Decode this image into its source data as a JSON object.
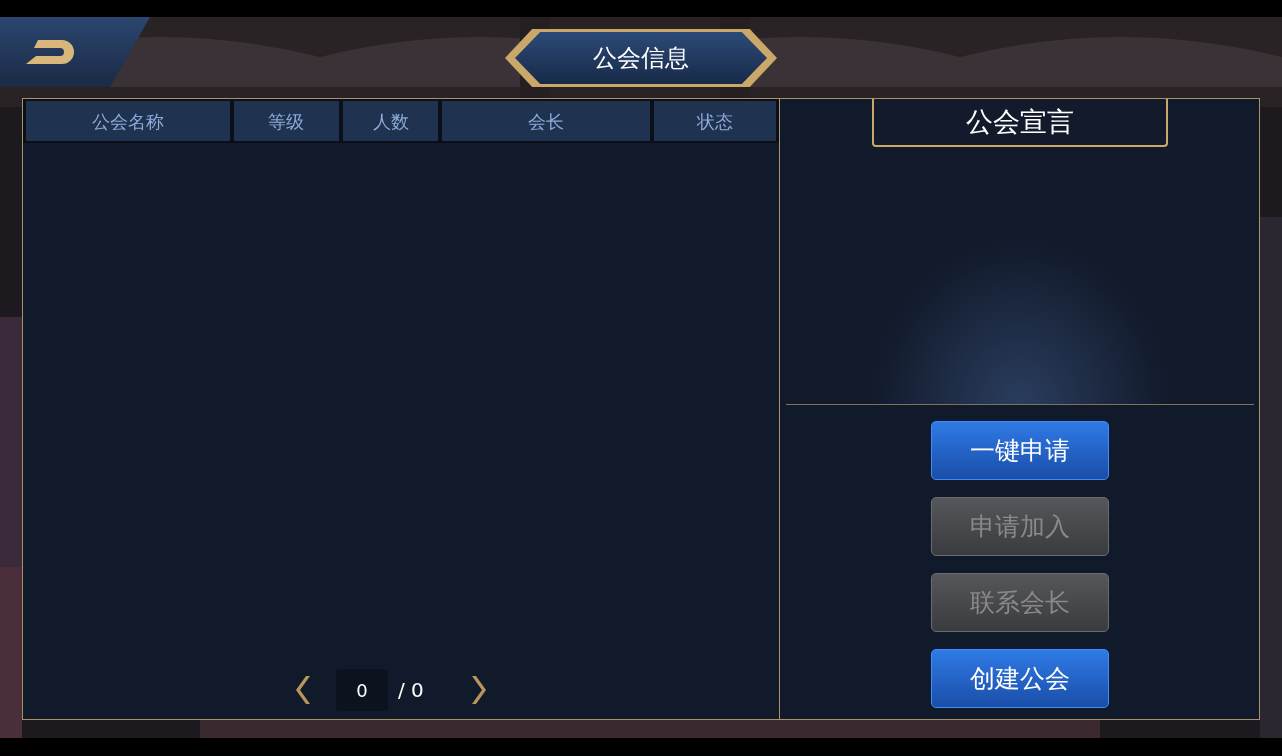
{
  "header": {
    "title": "公会信息"
  },
  "table": {
    "columns": [
      "公会名称",
      "等级",
      "人数",
      "会长",
      "状态"
    ]
  },
  "pager": {
    "page": "0",
    "total": "/ 0"
  },
  "declaration": {
    "title": "公会宣言"
  },
  "buttons": [
    {
      "label": "一键申请",
      "disabled": false
    },
    {
      "label": "申请加入",
      "disabled": true
    },
    {
      "label": "联系会长",
      "disabled": true
    },
    {
      "label": "创建公会",
      "disabled": false
    }
  ]
}
